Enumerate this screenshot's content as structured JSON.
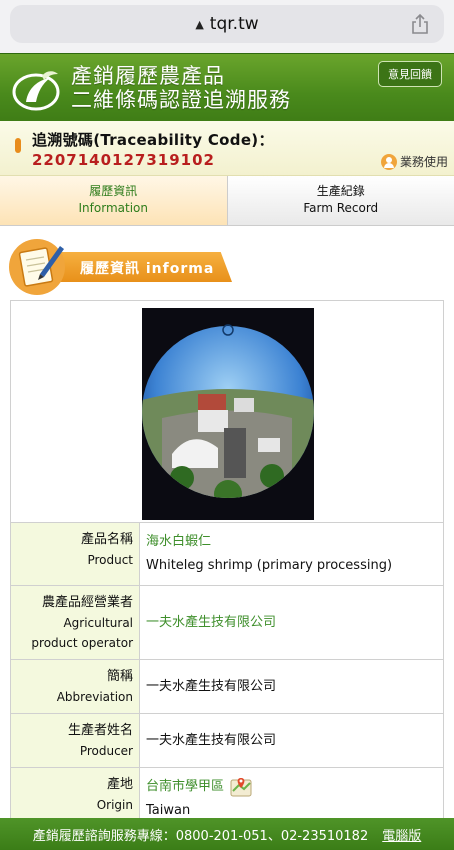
{
  "browser": {
    "url": "tqr.tw"
  },
  "header": {
    "title_line1": "產銷履歷農產品",
    "title_line2": "二維條碼認證追溯服務",
    "feedback_label": "意見回饋"
  },
  "trace": {
    "label": "追溯號碼(Traceability Code)：",
    "code": "2207140127319102",
    "business_label": "業務使用"
  },
  "tabs": [
    {
      "label_zh": "履歷資訊",
      "label_en": "Information",
      "active": true
    },
    {
      "label_zh": "生產紀錄",
      "label_en": "Farm Record",
      "active": false
    }
  ],
  "section": {
    "heading": "履歷資訊 informa"
  },
  "info_rows": [
    {
      "label_zh": "產品名稱",
      "label_en": "Product",
      "value_zh": "海水白蝦仁",
      "value_en": "Whiteleg shrimp (primary processing)"
    },
    {
      "label_zh": "農產品經營業者",
      "label_en": "Agricultural product operator",
      "value_zh": "一夫水產生技有限公司",
      "value_en": ""
    },
    {
      "label_zh": "簡稱",
      "label_en": "Abbreviation",
      "value_zh": "一夫水產生技有限公司",
      "value_en": ""
    },
    {
      "label_zh": "生產者姓名",
      "label_en": "Producer",
      "value_zh": "一夫水產生技有限公司",
      "value_en": ""
    },
    {
      "label_zh": "產地",
      "label_en": "Origin",
      "value_zh": "台南市學甲區",
      "value_en": "Taiwan"
    }
  ],
  "footer": {
    "hotline": "產銷履歷諮詢服務專線：0800-201-051、02-23510182",
    "desktop_label": "電腦版"
  },
  "colors": {
    "brand_green": "#4a8a1c",
    "trace_code_red": "#b81e1e",
    "accent_orange": "#e8901a"
  }
}
